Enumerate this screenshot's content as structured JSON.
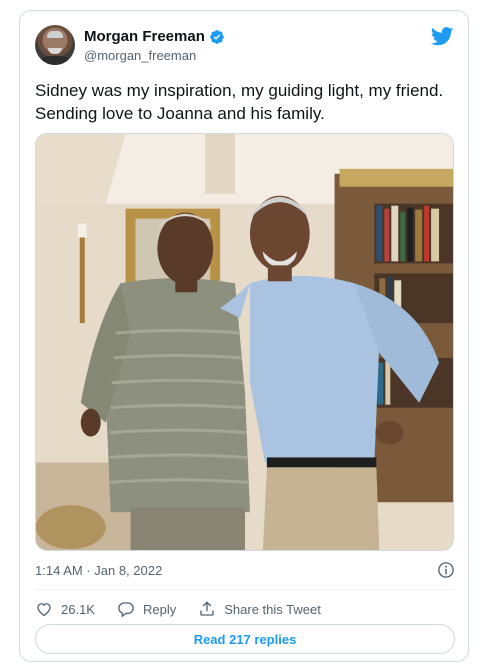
{
  "author": {
    "name": "Morgan Freeman",
    "handle": "@morgan_freeman",
    "verified": true
  },
  "tweet": {
    "text": "Sidney was my inspiration, my guiding light, my friend. Sending love to Joanna and his family.",
    "timestamp": "1:14 AM · Jan 8, 2022"
  },
  "actions": {
    "like_count": "26.1K",
    "reply_label": "Reply",
    "share_label": "Share this Tweet"
  },
  "read_replies_label": "Read 217 replies",
  "icons": {
    "platform": "twitter-bird-icon",
    "verified": "verified-badge-icon",
    "info": "info-icon",
    "like": "heart-icon",
    "reply": "reply-icon",
    "share": "share-icon"
  },
  "colors": {
    "accent": "#1d9bf0",
    "secondary_text": "#536471",
    "border": "#cfd9de"
  }
}
